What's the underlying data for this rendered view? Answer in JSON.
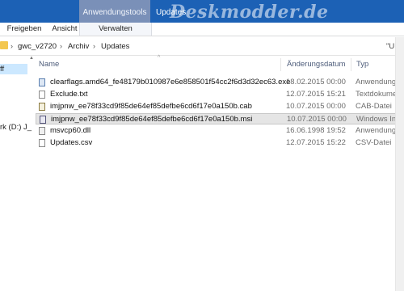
{
  "ribbon": {
    "context_label": "Anwendungstools",
    "title_fragment": "Updates",
    "watermark": "Deskmodder.de",
    "tabs": [
      "Freigeben",
      "Ansicht",
      "Verwalten"
    ],
    "accent_color": "#1c61b5"
  },
  "address": {
    "crumbs": [
      "gwc_v2720",
      "Archiv",
      "Updates"
    ],
    "search_fragment": "\"U"
  },
  "nav": {
    "selected_fragment": "ff",
    "drive_fragment": "rk (D:) J_"
  },
  "columns": [
    "Name",
    "Änderungsdatum",
    "Typ"
  ],
  "files": [
    {
      "name": "clearflags.amd64_fe48179b010987e6e858501f54cc2f6d3d32ec63.exe",
      "date": "18.02.2015 00:00",
      "type": "Anwendung",
      "icon": "exe-icon"
    },
    {
      "name": "Exclude.txt",
      "date": "12.07.2015 15:21",
      "type": "Textdokument",
      "icon": "text-file-icon"
    },
    {
      "name": "imjpnw_ee78f33cd9f85de64ef85defbe6cd6f17e0a150b.cab",
      "date": "10.07.2015 00:00",
      "type": "CAB-Datei",
      "icon": "cab-icon"
    },
    {
      "name": "imjpnw_ee78f33cd9f85de64ef85defbe6cd6f17e0a150b.msi",
      "date": "10.07.2015 00:00",
      "type": "Windows Install",
      "icon": "msi-icon",
      "selected": true
    },
    {
      "name": "msvcp60.dll",
      "date": "16.06.1998 19:52",
      "type": "Anwendungserw",
      "icon": "dll-icon"
    },
    {
      "name": "Updates.csv",
      "date": "12.07.2015 15:22",
      "type": "CSV-Datei",
      "icon": "csv-icon"
    }
  ]
}
